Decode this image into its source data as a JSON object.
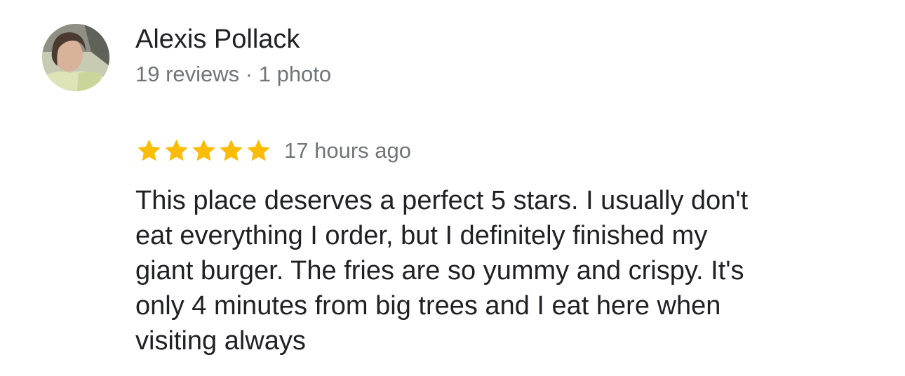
{
  "author": {
    "name": "Alexis Pollack",
    "meta": "19 reviews · 1 photo",
    "avatar_icon": "profile-photo"
  },
  "review": {
    "rating": 5,
    "rating_max": 5,
    "star_color": "#fbbc04",
    "time_ago": "17 hours ago",
    "text_lines": [
      "This place deserves a perfect 5 stars. I usually don't",
      "eat everything I order, but I definitely finished my",
      "giant burger. The fries are so yummy and crispy. It's",
      "only 4 minutes from big trees and I eat here when",
      "visiting always"
    ]
  }
}
